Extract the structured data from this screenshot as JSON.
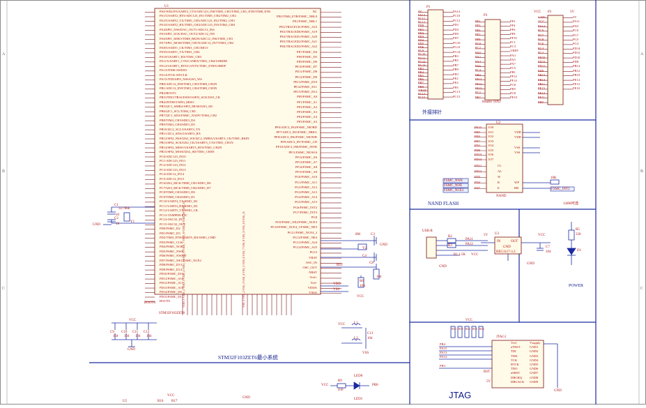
{
  "sheet": {
    "title": "STM32F103ZET6最小系统",
    "zone_letters": [
      "A",
      "B",
      "C"
    ],
    "zone_numbers": [
      "1",
      "2",
      "3",
      "4"
    ]
  },
  "mcu": {
    "ref": "U1",
    "part": "STM32F103ZET6",
    "left_pins": [
      "PA0-WKUP/USART2_CTS/ADC123_IN0/TIM5_CH1/TIM2_CH1_ETR/TIM8_ETR",
      "PA1/USART2_RTS/ADC123_IN1/TIM5_CH2/TIM2_CH2",
      "PA2/USART2_TX/TIM5_CH3/ADC123_IN2/TIM2_CH3",
      "PA3/USART2_RX/TIM5_CH4/ADC123_IN3/TIM2_CH4",
      "PA4/SPI1_NSS/DAC_OUT1/ADC12_IN4",
      "PA5/SPI1_SCK/DAC_OUT2/ADC12_IN5",
      "PA6/SPI1_MISO/TIM8_BKIN/ADC12_IN6/TIM3_CH1",
      "PA7/SPI1_MOSI/TIM8_CH1N/ADC12_IN7/TIM3_CH2",
      "PA8/USART1_CK/TIM1_CH1/MCO",
      "PA9/USART1_TX/TIM1_CH2",
      "PA10/USART1_RX/TIM1_CH3",
      "PA11/USART1_CTS/CANRX/TIM1_CH4/USBDM",
      "PA12/USART1_RTS/CANTX/TIM1_ETR/USBDP",
      "PA13/JTMS-SWDIO",
      "PA14/JTCK-SWCLK",
      "PA15/JTDI/SPI3_NSS/I2S3_WS",
      "PB0/ADC12_IN8/TIM3_CH3/TIM8_CH2N",
      "PB1/ADC12_IN9/TIM3_CH4/TIM8_CH3N",
      "PB2/BOOT1",
      "PB3/JTDO/TRACESWO/SPI3_SCK/I2S3_CK",
      "PB4/JNTRST/SPI3_MISO",
      "PB5/I2C1_SMBA/SPI3_MOSI/I2S3_SD",
      "PB6/I2C1_SCL/TIM4_CH1",
      "PB7/I2C1_SDA/FSMC_NADV/TIM4_CH2",
      "PB8/TIM4_CH3/SDIO_D4",
      "PB9/TIM4_CH4/SDIO_D5",
      "PB10/I2C2_SCL/USART3_TX",
      "PB11/I2C2_SDA/USART3_RX",
      "PB12/SPI2_NSS/I2S2_WS/I2C2_SMBA/USART3_CK/TIM1_BKIN",
      "PB13/SPI2_SCK/I2S2_CK/USART3_CTS/TIM1_CH1N",
      "PB14/SPI2_MISO/USART3_RTS/TIM1_CH2N",
      "PB15/SPI2_MOSI/I2S2_SD/TIM1_CH3N",
      "PC0/ADC123_IN10",
      "PC1/ADC123_IN11",
      "PC2/ADC123_IN12",
      "PC3/ADC123_IN13",
      "PC4/ADC12_IN14",
      "PC5/ADC12_IN15",
      "PC6/I2S2_MCK/TIM8_CH1/SDIO_D6",
      "PC7/I2S3_MCK/TIM8_CH2/SDIO_D7",
      "PC8/TIM8_CH3/SDIO_D0",
      "PC9/TIM8_CH4/SDIO_D1",
      "PC10/UART4_TX/SDIO_D2",
      "PC11/UART4_RX/SDIO_D3",
      "PC12/UART5_TX/SDIO_CK",
      "PC13-TAMPER-RTC",
      "PC14-OSC32_IN",
      "PC15-OSC32_OUT",
      "PD0/FSMC_D2",
      "PD1/FSMC_D3",
      "PD2/TIM3_ETR/UART5_RX/SDIO_CMD",
      "PD3/FSMC_CLK",
      "PD4/FSMC_NOE",
      "PD5/FSMC_NWE",
      "PD6/FSMC_NWAIT",
      "PD7/FSMC_NE1/FSMC_NCE2",
      "PD8/FSMC_D13",
      "PD9/FSMC_D14",
      "PD10/FSMC_D15",
      "PD11/FSMC_A16",
      "PD12/FSMC_A17",
      "PD13/FSMC_A18",
      "PD14/FSMC_D0",
      "PD15/FSMC_D1",
      "BOOT0"
    ],
    "right_pins": [
      "NC",
      "PE0/TIM4_ETR/FSMC_NBL0",
      "PE1/FSMC_NBL1",
      "PE2/TRACECK/FSMC_A23",
      "PE3/TRACED0/FSMC_A19",
      "PE4/TRACED1/FSMC_A20",
      "PE5/TRACED2/FSMC_A21",
      "PE6/TRACED3/FSMC_A22",
      "PE7/FSMC_D4",
      "PE8/FSMC_D5",
      "PE9/FSMC_D6",
      "PE10/FSMC_D7",
      "PE11/FSMC_D8",
      "PE12/FSMC_D9",
      "PE13/FSMC_D10",
      "PE14/FSMC_D11",
      "PE15/FSMC_D12",
      "PF0/FSMC_A0",
      "PF1/FSMC_A1",
      "PF2/FSMC_A2",
      "PF3/FSMC_A3",
      "PF4/FSMC_A4",
      "PF5/FSMC_A5",
      "PF6/ADC3_IN4/FSMC_NIORD",
      "PF7/ADC3_IN5/FSMC_NREG",
      "PF8/ADC3_IN6/FSMC_NIOWR",
      "PF9/ADC3_IN7/FSMC_CD",
      "PF10/ADC3_IN8/FSMC_INTR",
      "PF11/FSMC_NIOS16",
      "PF12/FSMC_A6",
      "PF13/FSMC_A7",
      "PF14/FSMC_A8",
      "PF15/FSMC_A9",
      "PG0/FSMC_A10",
      "PG1/FSMC_A11",
      "PG2/FSMC_A12",
      "PG3/FSMC_A13",
      "PG4/FSMC_A14",
      "PG5/FSMC_A15",
      "PG6/FSMC_INT2",
      "PG7/FSMC_INT3",
      "PG8",
      "PG9/FSMC_NE2/FSMC_NCE3",
      "PG10/FSMC_NCE4_1/FSMC_NE3",
      "PG11/FSMC_NCE4_2",
      "PG12/FSMC_NE4",
      "PG13/FSMC_A24",
      "PG14/FSMC_A25",
      "PG15",
      "VBAT",
      "OSC_IN",
      "OSC_OUT",
      "NRST",
      "Vref+",
      "Vref-",
      "VDDA",
      "VSSA"
    ],
    "power_pins_label": "VDD_1 VDD_2 VDD_3 VDD_4 VDD_5 VDD_6 VDD_7 VDD_8 VDD_9 VDD_10 VDD_11",
    "gnd_pins_label": "VSS_1 VSS_2 VSS_3 VSS_4 VSS_5 VSS_6 VSS_7 VSS_8 VSS_9 VSS_10 VSS_11",
    "reset_net": "RST",
    "boot_net": "BOOT0"
  },
  "crystal32k": {
    "ref": "Y1",
    "freq": "32.768k",
    "c1": "C1",
    "c2": "C2",
    "cval": "10",
    "gnd": "GND"
  },
  "crystal8m": {
    "ref": "Y2",
    "freq": "8M",
    "c1": "C3",
    "c2": "C4",
    "cval": "22"
  },
  "decoupling": {
    "net": "VCC",
    "caps": [
      "C9",
      "C10",
      "C11",
      "C12"
    ],
    "val": "104",
    "gnd": "GND"
  },
  "headers": {
    "p1": {
      "ref": "P1",
      "left_nets": [
        "NC",
        "PA15",
        "PC11",
        "PC12",
        "PD0",
        "PD1",
        "PD2",
        "PD3",
        "PD4",
        "PD5",
        "PD6",
        "PG9",
        "PG10",
        "PG11",
        "PG12",
        "PG13",
        "PB3",
        "PB4",
        "PB5",
        "PB6",
        "PB7",
        "PB8",
        "VBAT",
        "PC14",
        "PC15"
      ],
      "right_nets": [
        "PA14",
        "PC10",
        "PC12",
        "PD1",
        "PD3",
        "PD5",
        "PD7",
        "PG10",
        "PG12",
        "PG14",
        "PB3",
        "PB5",
        "PB7",
        "PB9",
        "PE0",
        "PE2",
        "PE4",
        "PE6",
        "PC13",
        "PC15"
      ],
      "caption": "外接排针"
    },
    "p3": {
      "ref": "P3",
      "left_nets": [
        "PF1",
        "PF3",
        "PF5",
        "PF7",
        "PF9",
        "PC0",
        "PC2",
        "PA0",
        "PA2",
        "PA4",
        "PA6",
        "PC4",
        "PB0",
        "PF11",
        "PF13",
        "PF15",
        "PG1",
        "PE7"
      ],
      "right_nets": [
        "PF2",
        "PF4",
        "PF6",
        "PF8",
        "PF10",
        "PC1",
        "PC3",
        "VREF",
        "PA3",
        "PA5",
        "PA7",
        "PC5",
        "PB1",
        "PF12",
        "PF14",
        "PG0",
        "PE8",
        "PG0",
        "PE10"
      ],
      "caption": "Header 18X2"
    },
    "p2": {
      "ref": "P2",
      "left_nets": [
        "GND",
        "VCC",
        "PA13",
        "PC9",
        "PC7",
        "PG8",
        "PG6",
        "PG4",
        "PG2",
        "PD15",
        "PD13",
        "PD11",
        "PD9",
        "PB15",
        "PB13",
        "PB11",
        "PE15",
        "PE13",
        "PE11",
        "PE9"
      ],
      "right_nets": [
        "5V",
        "PA11",
        "PA9",
        "PC6",
        "PG7",
        "PG5",
        "PG3",
        "PD14",
        "PD12",
        "PD10",
        "PD8",
        "PB14",
        "PB12",
        "PB10",
        "PE14",
        "PE12",
        "PE10"
      ],
      "vcc": "VCC",
      "v5": "5V"
    }
  },
  "nand": {
    "ref": "U2",
    "part": "NAND",
    "title": "NAND FLASH",
    "data_nets": [
      "PE10",
      "PE9",
      "PE8",
      "PE7",
      "PD1",
      "PD0",
      "PD15",
      "PD14"
    ],
    "pins_left": [
      "IO0",
      "IO1",
      "IO2",
      "IO3",
      "IO4",
      "IO5",
      "IO6",
      "IO7"
    ],
    "ctrl_nets": [
      "PD11",
      "PD12",
      "PD5",
      "PD4",
      "PD7"
    ],
    "ctrl_pins": [
      "CL",
      "AL",
      "W",
      "R",
      "E"
    ],
    "fsmc_labels": [
      "FSMC_NWE",
      "FSMC_NOE",
      "FSMC_NCE2"
    ],
    "right_pins": [
      "VDD",
      "VDD",
      "VSS",
      "VSS",
      "WP",
      "RB"
    ],
    "rb_net": "FSMC_INT2",
    "pullup": "10K",
    "note": "128M可选"
  },
  "usb": {
    "ref": "J1",
    "name": "USB-B",
    "r1": "R2",
    "r2": "R3",
    "rval": "22",
    "nets": [
      "PA11",
      "PA12"
    ],
    "pull": "R1 1.5K",
    "vcc": "VCC",
    "gnd": "GND"
  },
  "regulator": {
    "ref": "U3",
    "part": "REG1117-3.3",
    "in": "IN",
    "out": "OUT",
    "gnd": "GND",
    "v5": "5V",
    "vcc": "VCC",
    "c5": "C5",
    "c6": "C6",
    "c7": "C7",
    "cap": "104",
    "title": "POWER"
  },
  "power_led": {
    "res": "R5",
    "rval": "330",
    "led": "D1"
  },
  "reset": {
    "res": "R4",
    "rval": "10K",
    "cap": "C8",
    "cval": "104",
    "net": "RST",
    "vcc": "VCC"
  },
  "boot": {
    "res": "R6",
    "rval": "10K",
    "net": "BOOT0"
  },
  "vdda": {
    "l1": "L1",
    "l2": "L2",
    "c": "C13",
    "c2": "C14",
    "cval": "104",
    "vdd": "VDD",
    "vss": "VSS",
    "vcc": "VCC"
  },
  "jtag": {
    "ref": "JTAG1",
    "title": "JTAG",
    "left": [
      "Vref",
      "nTRST",
      "TDI",
      "TMS",
      "TCK",
      "RTCK",
      "TDO",
      "nSRST",
      "DBGRQ",
      "DBGACK"
    ],
    "right": [
      "Vsupply",
      "GND1",
      "GND2",
      "GND3",
      "GND4",
      "GND5",
      "GND6",
      "GND7",
      "GND8",
      "GND9"
    ],
    "nets": [
      "PB4",
      "PA15",
      "PA13",
      "PA14",
      "PB3"
    ],
    "res": [
      "R10",
      "R11",
      "R12",
      "R13",
      "R14"
    ],
    "rval": "10K",
    "rst": "RST",
    "v5": "5V",
    "gnd": "GND",
    "vcc": "VCC"
  },
  "leds": {
    "r": "R9",
    "rval": "430",
    "led": "LED0",
    "led1": "LED1",
    "net": "PB0",
    "vcc": "VCC"
  },
  "bottom": {
    "ref": "U5",
    "r": "R16",
    "r2": "R17",
    "vcc": "VCC",
    "gnd": "GND"
  }
}
